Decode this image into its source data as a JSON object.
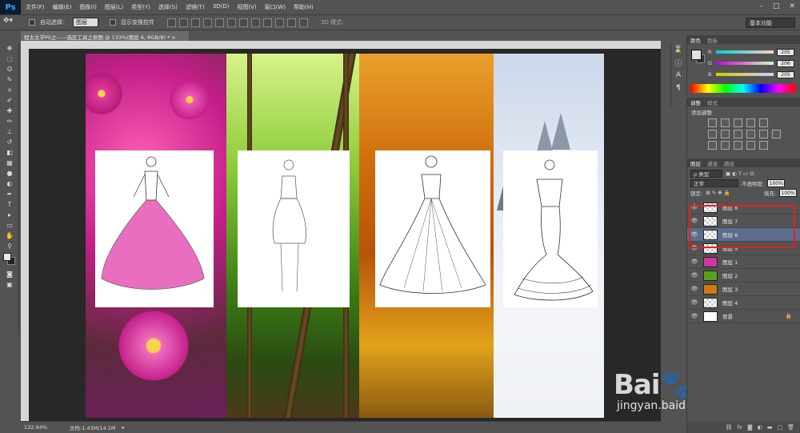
{
  "app": {
    "logo": "Ps"
  },
  "menu": [
    "文件(F)",
    "编辑(E)",
    "图像(I)",
    "图层(L)",
    "类型(Y)",
    "选择(S)",
    "滤镜(T)",
    "3D(D)",
    "视图(V)",
    "窗口(W)",
    "帮助(H)"
  ],
  "window_controls": {
    "minimize": "–",
    "maximize": "□",
    "close": "✕"
  },
  "options": {
    "auto_select_label": "自动选择：",
    "auto_select_value": "图层",
    "show_transform_label": "显示变换控件",
    "mode3d_label": "3D 模式:",
    "workspace_value": "基本功能"
  },
  "tools": [
    "move-tool",
    "marquee-tool",
    "lasso-tool",
    "quick-select-tool",
    "crop-tool",
    "eyedropper-tool",
    "healing-tool",
    "brush-tool",
    "stamp-tool",
    "history-brush-tool",
    "eraser-tool",
    "gradient-tool",
    "blur-tool",
    "dodge-tool",
    "pen-tool",
    "type-tool",
    "path-select-tool",
    "shape-tool",
    "hand-tool",
    "zoom-tool"
  ],
  "tool_glyphs": [
    "✥",
    "⬚",
    "ʘ",
    "✎",
    "⌗",
    "✐",
    "✚",
    "✏",
    "⊥",
    "↺",
    "◧",
    "▦",
    "●",
    "◐",
    "✒",
    "T",
    "▸",
    "▭",
    "✋",
    "⚲"
  ],
  "document": {
    "tab_title": "程太太学PS之——选区工具之抠图 @ 133%(图层 6, RGB/8) *",
    "tab_close": "×"
  },
  "status": {
    "zoom": "132.94%",
    "doc_info": "文档:1.43M/14.1M"
  },
  "watermark": {
    "main": "Bai🐾经验",
    "sub": "jingyan.baidu.com"
  },
  "color_panel": {
    "tabs": [
      "颜色",
      "色板"
    ],
    "channels": [
      {
        "label": "R",
        "value": "205"
      },
      {
        "label": "G",
        "value": "206"
      },
      {
        "label": "B",
        "value": "205"
      }
    ]
  },
  "adjust_panel": {
    "tabs": [
      "调整",
      "样式"
    ],
    "title": "添加调整"
  },
  "layers_panel": {
    "tabs": [
      "图层",
      "通道",
      "路径"
    ],
    "filter_label": "ρ 类型",
    "blend_mode": "正常",
    "opacity_label": "不透明度:",
    "opacity_value": "100%",
    "lock_label": "锁定:",
    "fill_label": "填充:",
    "fill_value": "100%",
    "layers": [
      {
        "name": "图层 8",
        "selected": false,
        "thumb": "transparent"
      },
      {
        "name": "图层 7",
        "selected": false,
        "thumb": "transparent"
      },
      {
        "name": "图层 6",
        "selected": true,
        "thumb": "transparent"
      },
      {
        "name": "图层 5",
        "selected": false,
        "thumb": "transparent"
      },
      {
        "name": "图层 1",
        "selected": false,
        "thumb": "#d2359a"
      },
      {
        "name": "图层 2",
        "selected": false,
        "thumb": "#5aa01f"
      },
      {
        "name": "图层 3",
        "selected": false,
        "thumb": "#d27a12"
      },
      {
        "name": "图层 4",
        "selected": false,
        "thumb": "transparent"
      },
      {
        "name": "背景",
        "selected": false,
        "thumb": "#ffffff",
        "locked": true
      }
    ],
    "bottom_icons": [
      "link-icon",
      "fx-icon",
      "mask-icon",
      "adjust-icon",
      "group-icon",
      "new-layer-icon",
      "trash-icon"
    ]
  },
  "colors": {
    "accent_selected": "#5c6d8c",
    "highlight_box": "#e02020"
  }
}
